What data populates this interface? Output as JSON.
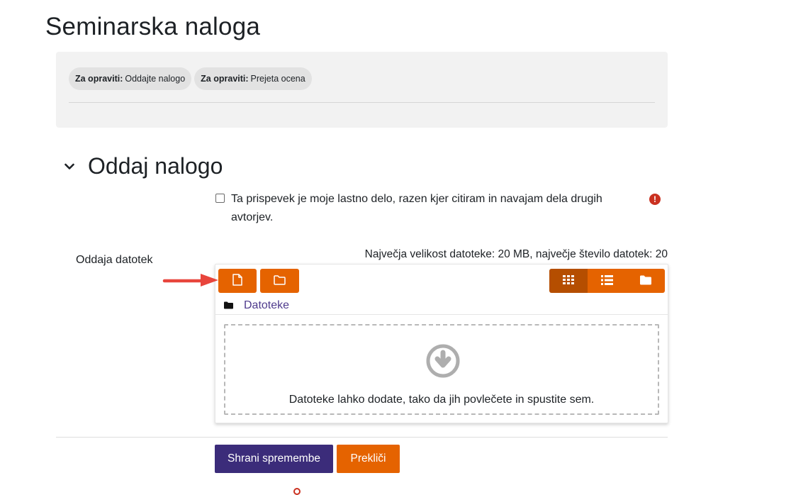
{
  "page": {
    "title": "Seminarska naloga"
  },
  "activity": {
    "todos": [
      {
        "label": "Za opraviti:",
        "value": "Oddajte nalogo"
      },
      {
        "label": "Za opraviti:",
        "value": "Prejeta ocena"
      }
    ]
  },
  "section": {
    "title": "Oddaj nalogo"
  },
  "agreement": {
    "text": "Ta prispevek je moje lastno delo, razen kjer citiram in navajam dela drugih avtorjev.",
    "checked": false
  },
  "file_submission": {
    "label": "Oddaja datotek",
    "limits": "Največja velikost datoteke: 20 MB, največje število datotek: 20",
    "path": "Datoteke",
    "dropzone_text": "Datoteke lahko dodate, tako da jih povlečete in spustite sem.",
    "toolbar_icons": [
      "add-file-icon",
      "create-folder-icon"
    ],
    "view_icons": [
      "grid-view-icon",
      "list-view-icon",
      "tree-view-icon"
    ],
    "active_view": "grid-view-icon"
  },
  "buttons": {
    "save": "Shrani spremembe",
    "cancel": "Prekliči"
  },
  "colors": {
    "primary": "#3b2c7a",
    "accent": "#e56300",
    "accent_active": "#b54e00",
    "required": "#ca3120",
    "annotation_arrow": "#e8453c"
  }
}
